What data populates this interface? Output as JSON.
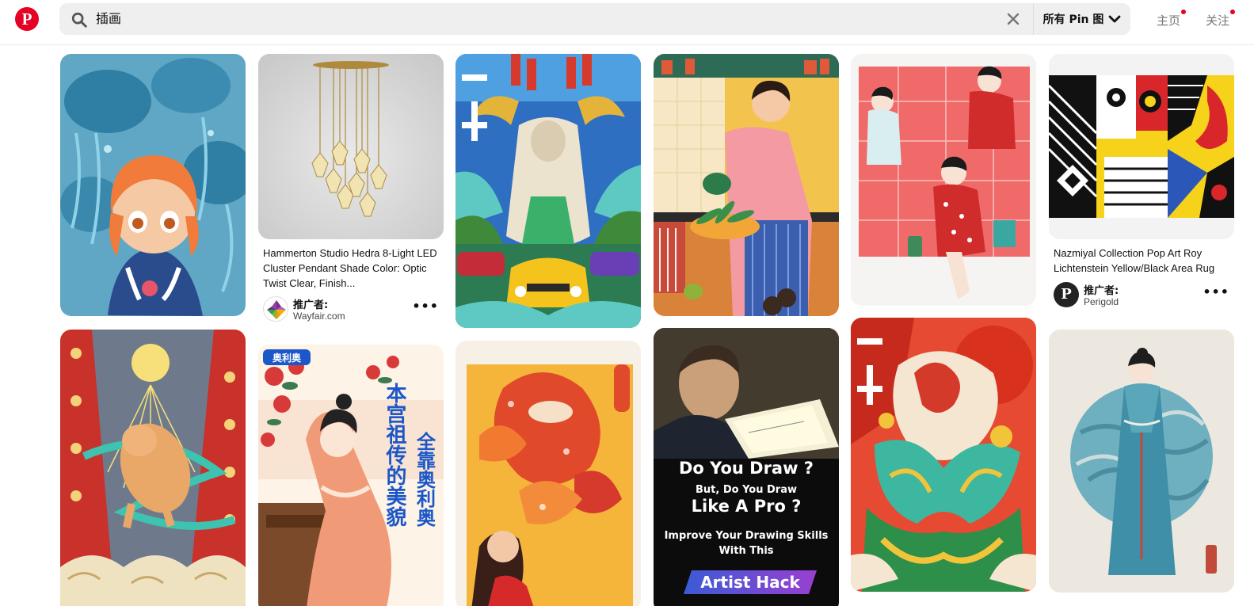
{
  "header": {
    "logo_glyph": "P",
    "search_value": "插画",
    "filter_label": "所有 Pin 图",
    "nav": [
      "主页",
      "关注"
    ]
  },
  "pins": [
    {
      "id": "jellyfish-girl",
      "image": "illustration of orange-haired girl among blue jellyfish"
    },
    {
      "id": "pendant-light",
      "title": "Hammerton Studio Hedra 8-Light LED Cluster Pendant Shade Color: Optic Twist Clear, Finish...",
      "promoted_by": "推广者:",
      "advertiser": "Wayfair.com"
    },
    {
      "id": "goat-poster",
      "image": "illustration of goat deity with yellow car"
    },
    {
      "id": "kitchen-man",
      "image": "illustration of man cooking in kitchen"
    },
    {
      "id": "red-women",
      "image": "illustration of women in red shopping"
    },
    {
      "id": "pop-art-rug",
      "title": "Nazmiyal Collection Pop Art Roy Lichtenstein Yellow/Black Area Rug",
      "promoted_by": "推广者:",
      "advertiser": "Perigold",
      "avatar_letter": "P"
    },
    {
      "id": "golden-pig",
      "image": "illustration of golden pig under sun"
    },
    {
      "id": "tang-lady-poster",
      "poster_text": [
        "本宫祖传的美貌",
        "全靠奥利奥"
      ],
      "badge": "奥利奥"
    },
    {
      "id": "koi-girl",
      "image": "illustration of girl with koi fish"
    },
    {
      "id": "artist-hack",
      "lines": [
        "Do You Draw ?",
        "But, Do You Draw",
        "Like A Pro ?",
        "Improve Your Drawing Skills",
        "With This"
      ],
      "banner": "Artist Hack"
    },
    {
      "id": "phoenix-poster",
      "image": "illustration of phoenix with red sun"
    },
    {
      "id": "hanfu-lady",
      "image": "illustration of woman in blue hanfu"
    }
  ],
  "colors": {
    "brand": "#e60023",
    "search_bg": "#efefef",
    "text": "#111111",
    "nav_text": "#767676"
  }
}
